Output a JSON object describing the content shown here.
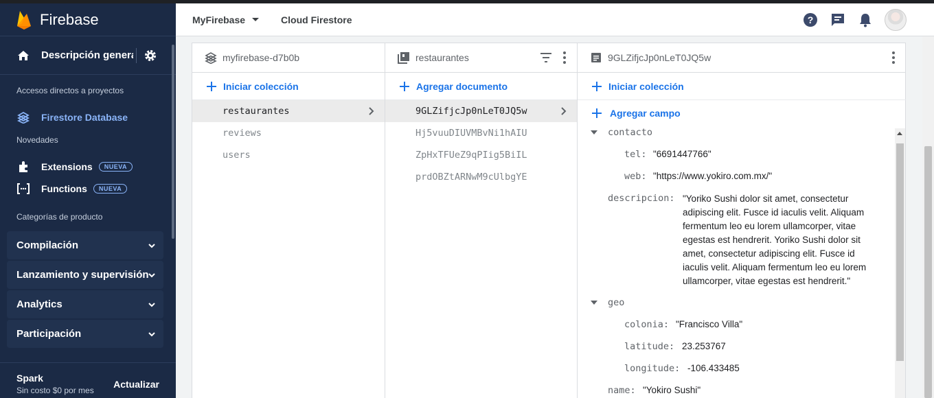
{
  "sidebar": {
    "brand": "Firebase",
    "overview": "Descripción general del proyecto",
    "shortcuts_section": "Accesos directos a proyectos",
    "firestore": "Firestore Database",
    "news_section": "Novedades",
    "extensions": "Extensions",
    "functions": "Functions",
    "new_badge": "NUEVA",
    "categories_section": "Categorías de producto",
    "groups": [
      "Compilación",
      "Lanzamiento y supervisión",
      "Analytics",
      "Participación"
    ],
    "plan_name": "Spark",
    "plan_sub": "Sin costo $0 por mes",
    "upgrade": "Actualizar"
  },
  "header": {
    "project": "MyFirebase",
    "crumb": "Cloud Firestore",
    "icons": [
      "help-icon",
      "feedback-icon",
      "notifications-icon",
      "avatar"
    ]
  },
  "columns": {
    "root": {
      "title": "myfirebase-d7b0b",
      "add": "Iniciar colección",
      "items": [
        "restaurantes",
        "reviews",
        "users"
      ]
    },
    "collection": {
      "title": "restaurantes",
      "add": "Agregar documento",
      "items": [
        "9GLZifjcJp0nLeT0JQ5w",
        "Hj5vuuDIUVMBvNi1hAIU",
        "ZpHxTFUeZ9qPIig5BiIL",
        "prdOBZtARNwM9cUlbgYE"
      ]
    },
    "document": {
      "title": "9GLZifjcJp0nLeT0JQ5w",
      "add_collection": "Iniciar colección",
      "add_field": "Agregar campo",
      "fields": {
        "contacto_key": "contacto",
        "tel_key": "tel:",
        "tel_val": "\"6691447766\"",
        "web_key": "web:",
        "web_val": "\"https://www.yokiro.com.mx/\"",
        "descripcion_key": "descripcion:",
        "descripcion_val": "\"Yoriko Sushi dolor sit amet, consectetur adipiscing elit. Fusce id iaculis velit. Aliquam fermentum leo eu lorem ullamcorper, vitae egestas est hendrerit. Yoriko Sushi dolor sit amet, consectetur adipiscing elit. Fusce id iaculis velit. Aliquam fermentum leo eu lorem ullamcorper, vitae egestas est hendrerit.\"",
        "geo_key": "geo",
        "colonia_key": "colonia:",
        "colonia_val": "\"Francisco Villa\"",
        "latitude_key": "latitude:",
        "latitude_val": "23.253767",
        "longitude_key": "longitude:",
        "longitude_val": "-106.433485",
        "name_key": "name:",
        "name_val": "\"Yokiro Sushi\""
      }
    }
  },
  "colors": {
    "accent": "#1a73e8",
    "sidebar": "#1b2a45",
    "active_nav": "#8ab4f8",
    "flame": "#ffa000"
  }
}
